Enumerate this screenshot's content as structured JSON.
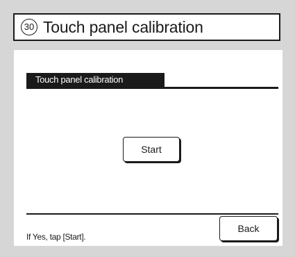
{
  "header": {
    "number": "30",
    "title": "Touch panel calibration"
  },
  "section": {
    "label": "Touch panel calibration"
  },
  "buttons": {
    "start": "Start",
    "back": "Back"
  },
  "footer": {
    "hint": "If Yes, tap [Start]."
  },
  "colors": {
    "background": "#d6d6d6",
    "panel": "#ffffff",
    "ink": "#1a1a1a"
  }
}
